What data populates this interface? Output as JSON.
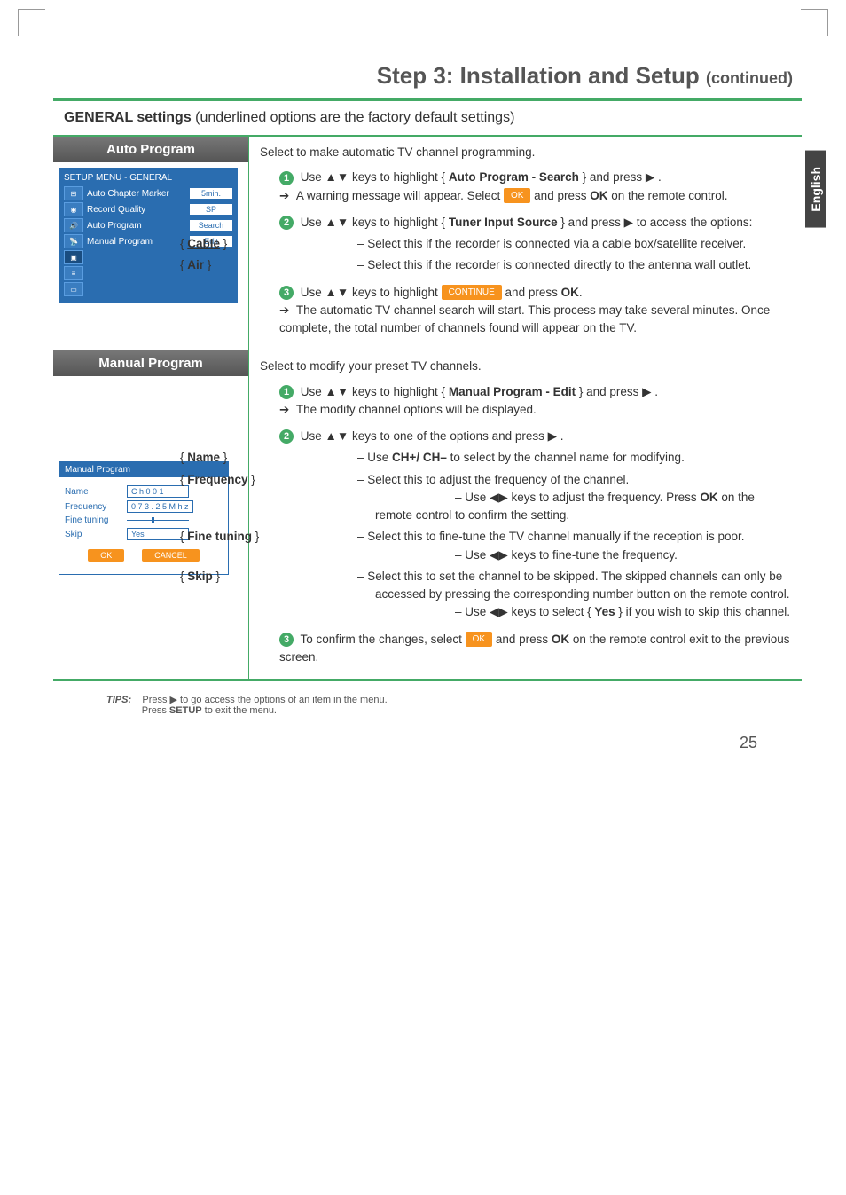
{
  "page": {
    "title_main": "Step 3: Installation and Setup ",
    "title_sub": "(continued)",
    "number": "25",
    "lang_tab": "English"
  },
  "gen": {
    "heading_bold": "GENERAL settings",
    "heading_rest": " (underlined options are the factory default settings)"
  },
  "auto": {
    "label": "Auto Program",
    "intro": "Select to make automatic TV channel programming.",
    "s1a": "Use ▲▼ keys to highlight  { ",
    "s1b": "Auto Program - Search",
    "s1c": " } and press ▶ .",
    "s1warn_a": "A warning message will appear. Select ",
    "s1warn_b": " and press ",
    "s1warn_c": "OK",
    "s1warn_d": " on the remote control.",
    "s2a": "Use ▲▼ keys to highlight  { ",
    "s2b": "Tuner Input Source",
    "s2c": " } and press ▶ to access the options:",
    "cable_k": "Cable",
    "cable_v": "– Select this if the recorder is connected via a cable box/satellite receiver.",
    "air_k": "Air",
    "air_v": "– Select this if the recorder is connected directly to the antenna wall outlet.",
    "s3a": "Use ▲▼ keys to highlight ",
    "s3b": " and press ",
    "s3c": "OK",
    "s3d": ".",
    "s3note": "The automatic TV channel search will start. This process may take several minutes. Once complete, the total number of channels found will appear on the TV."
  },
  "manual": {
    "label": "Manual Program",
    "intro": "Select to modify your preset TV channels.",
    "s1a": "Use ▲▼ keys to highlight  { ",
    "s1b": "Manual Program - Edit",
    "s1c": " } and press ▶ .",
    "s1note": "The modify channel options will be displayed.",
    "s2": "Use ▲▼ keys to one of the options and press ▶ .",
    "name_k": "Name",
    "name_v1": "– Use ",
    "name_v2": "CH+/ CH–",
    "name_v3": " to select by the channel name for modifying.",
    "freq_k": "Frequency",
    "freq_v1": "– Select this to adjust the frequency of the channel.",
    "freq_v2a": "– Use ◀▶ keys to adjust the frequency. Press ",
    "freq_v2b": "OK",
    "freq_v2c": " on the remote control to confirm the setting.",
    "fine_k": "Fine tuning",
    "fine_v1": "– Select this to fine-tune the TV channel manually if the reception is poor.",
    "fine_v2": "– Use ◀▶ keys to fine-tune the frequency.",
    "skip_k": "Skip",
    "skip_v1": "– Select this to set the channel to be skipped. The skipped channels can only be accessed by pressing the corresponding number button on the remote control.",
    "skip_v2a": "– Use  ◀▶ keys to select { ",
    "skip_v2b": "Yes",
    "skip_v2c": " } if you wish to skip this channel.",
    "s3a": "To confirm the changes, select ",
    "s3b": " and press ",
    "s3c": "OK",
    "s3d": " on the remote control exit to the previous screen."
  },
  "menu": {
    "title": "SETUP MENU - GENERAL",
    "r1l": "Auto Chapter Marker",
    "r1v": "5min.",
    "r2l": "Record Quality",
    "r2v": "SP",
    "r3l": "Auto Program",
    "r3v": "Search",
    "r4l": "Manual Program",
    "r4v": "Edit"
  },
  "mbox": {
    "title": "Manual Program",
    "r1l": "Name",
    "r1v": "C h 0 0 1",
    "r2l": "Frequency",
    "r2v": "0 7 3 . 2 5 M h z",
    "r3l": "Fine tuning",
    "r4l": "Skip",
    "r4v": "Yes",
    "ok": "OK",
    "cancel": "CANCEL"
  },
  "pills": {
    "ok": "OK",
    "cont": "CONTINUE"
  },
  "tips": {
    "lead": "TIPS:",
    "l1a": "Press ▶ to go access the options of an item in the menu.",
    "l2a": "Press ",
    "l2b": "SETUP",
    "l2c": " to exit the menu."
  }
}
